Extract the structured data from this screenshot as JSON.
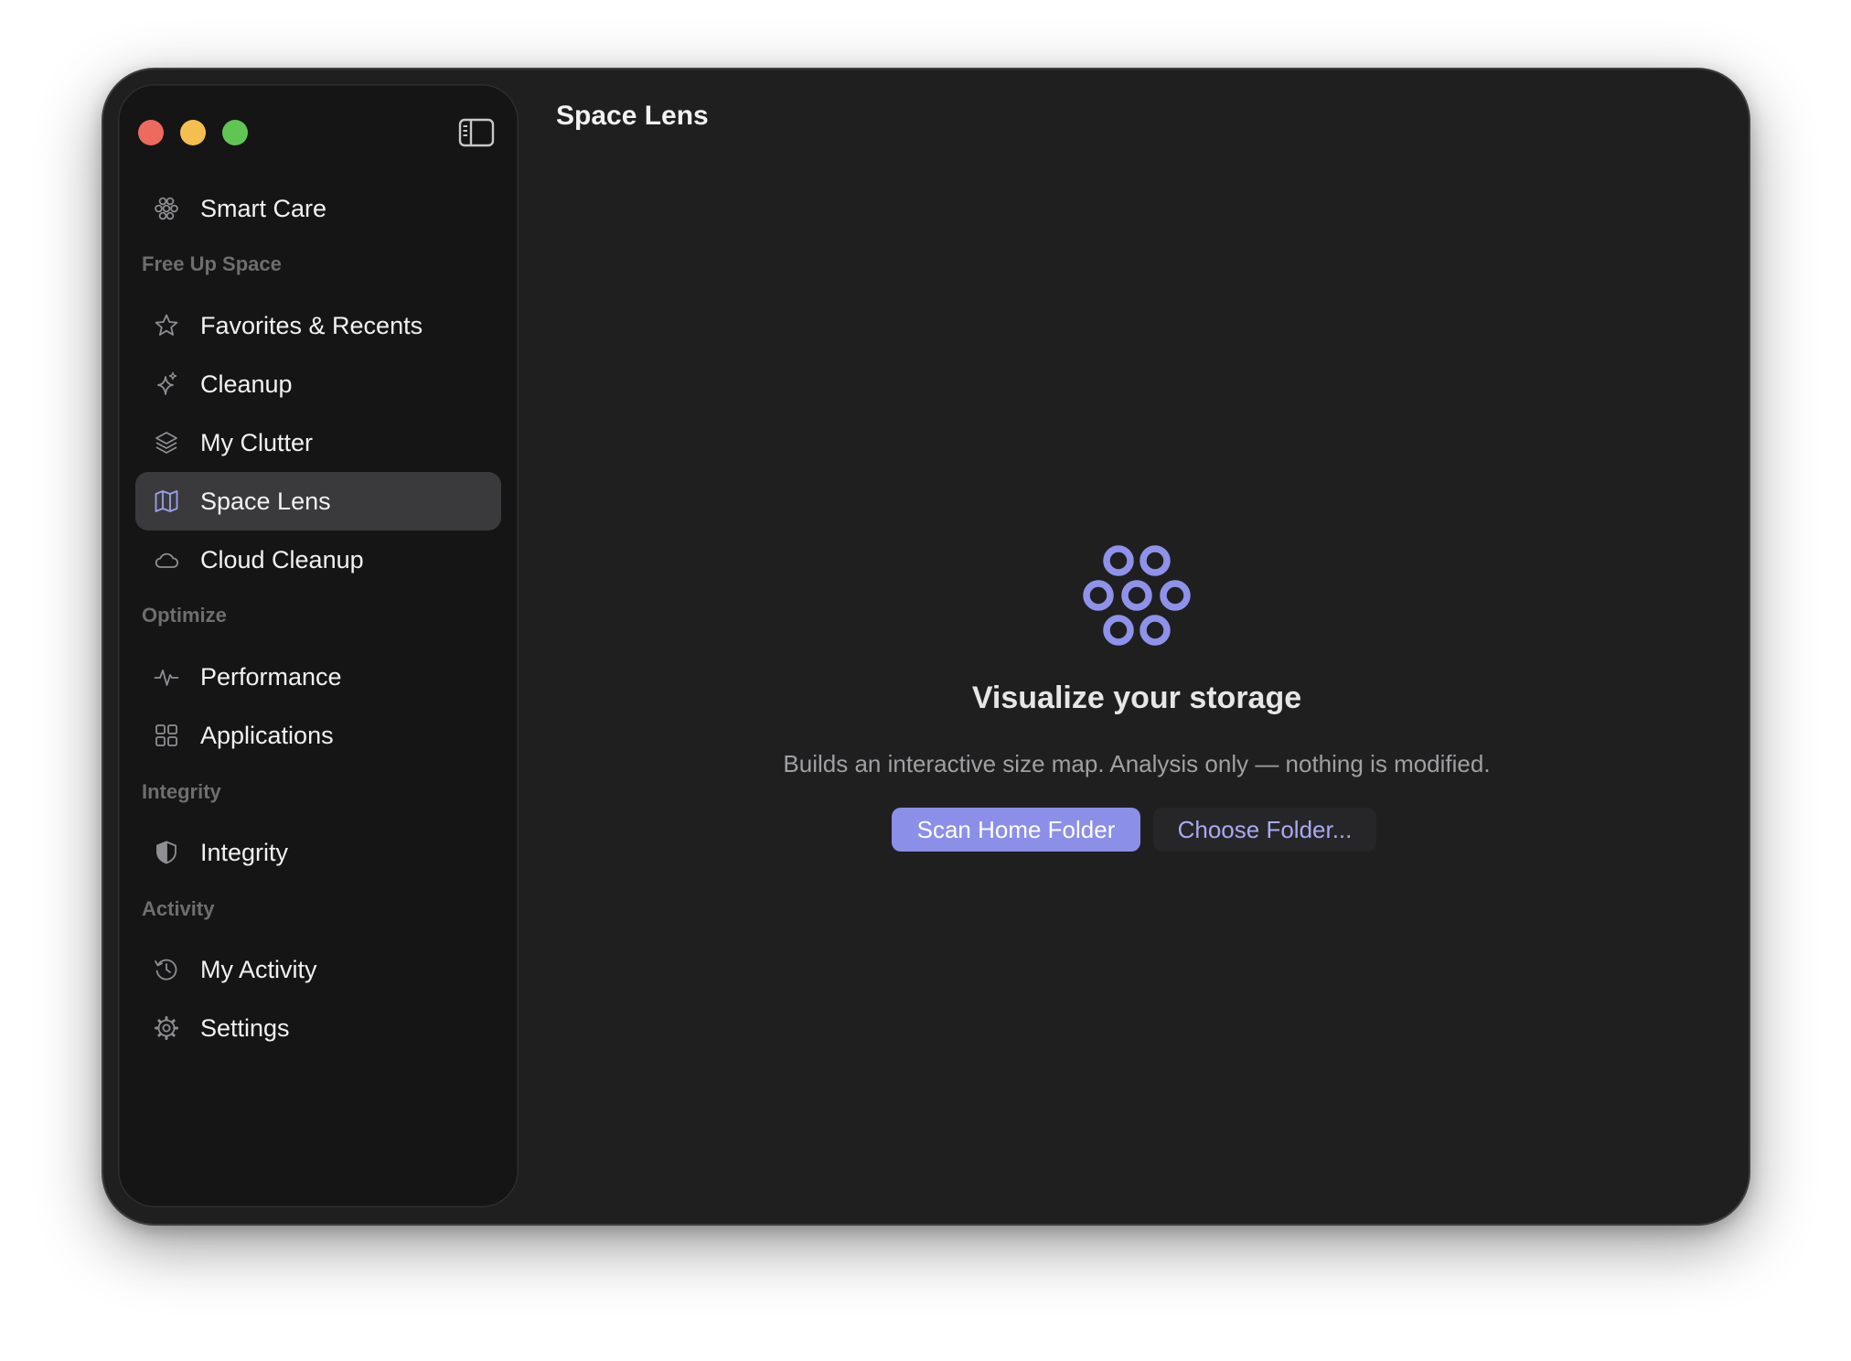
{
  "window": {
    "title": "Space Lens"
  },
  "sidebar": {
    "top_item": {
      "label": "Smart Care",
      "icon": "smart-care-icon"
    },
    "sections": {
      "free_up_space": {
        "title": "Free Up Space",
        "items": [
          {
            "label": "Favorites & Recents",
            "icon": "star-icon"
          },
          {
            "label": "Cleanup",
            "icon": "sparkle-icon"
          },
          {
            "label": "My Clutter",
            "icon": "layers-icon"
          },
          {
            "label": "Space Lens",
            "icon": "map-icon",
            "selected": true
          },
          {
            "label": "Cloud Cleanup",
            "icon": "cloud-icon"
          }
        ]
      },
      "optimize": {
        "title": "Optimize",
        "items": [
          {
            "label": "Performance",
            "icon": "pulse-icon"
          },
          {
            "label": "Applications",
            "icon": "grid-icon"
          }
        ]
      },
      "integrity": {
        "title": "Integrity",
        "items": [
          {
            "label": "Integrity",
            "icon": "shield-icon"
          }
        ]
      },
      "activity": {
        "title": "Activity",
        "items": [
          {
            "label": "My Activity",
            "icon": "history-icon"
          },
          {
            "label": "Settings",
            "icon": "gear-icon"
          }
        ]
      }
    }
  },
  "main": {
    "hero_icon": "bubbles-icon",
    "heading": "Visualize your storage",
    "subtitle": "Builds an interactive size map. Analysis only — nothing is modified.",
    "primary_button": "Scan Home Folder",
    "secondary_button": "Choose Folder..."
  },
  "colors": {
    "accent": "#8b8fe8",
    "accent_text": "#a7aaf2",
    "window_bg": "#1f1f1f",
    "sidebar_bg": "#151515",
    "selected_bg": "#3a3a3c",
    "close": "#ed6a5e",
    "minimize": "#f5bf4f",
    "zoom": "#61c554"
  }
}
